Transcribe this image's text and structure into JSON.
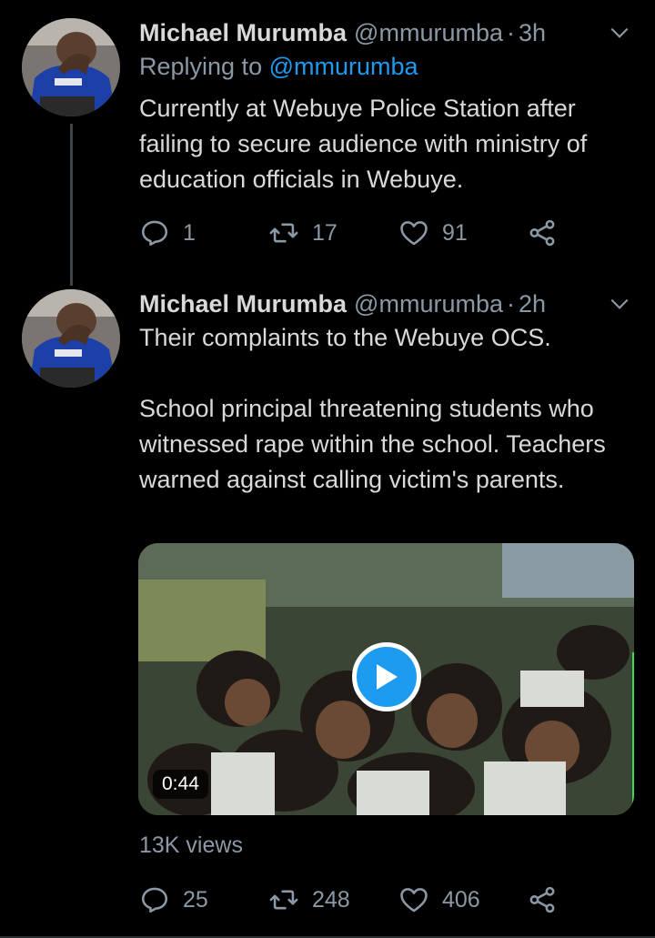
{
  "tweets": [
    {
      "name": "Michael Murumba",
      "handle": "@mmurumba",
      "separator": "·",
      "time": "3h",
      "replying_prefix": "Replying to ",
      "replying_to": "@mmurumba",
      "text": "Currently at Webuye Police Station after failing to secure audience with ministry of education officials in Webuye.",
      "replies": "1",
      "retweets": "17",
      "likes": "91"
    },
    {
      "name": "Michael Murumba",
      "handle": "@mmurumba",
      "separator": "·",
      "time": "2h",
      "text": "Their complaints to the Webuye OCS.\n\nSchool principal threatening students who witnessed rape within the school. Teachers warned against calling victim's parents.",
      "video_duration": "0:44",
      "views": "13K views",
      "replies": "25",
      "retweets": "248",
      "likes": "406"
    }
  ],
  "colors": {
    "background": "#000000",
    "text": "#d9d9d9",
    "muted": "#8b98a5",
    "accent": "#1d9bf0"
  },
  "icons": [
    "chevron-down-icon",
    "reply-icon",
    "retweet-icon",
    "like-icon",
    "share-icon",
    "play-icon"
  ]
}
